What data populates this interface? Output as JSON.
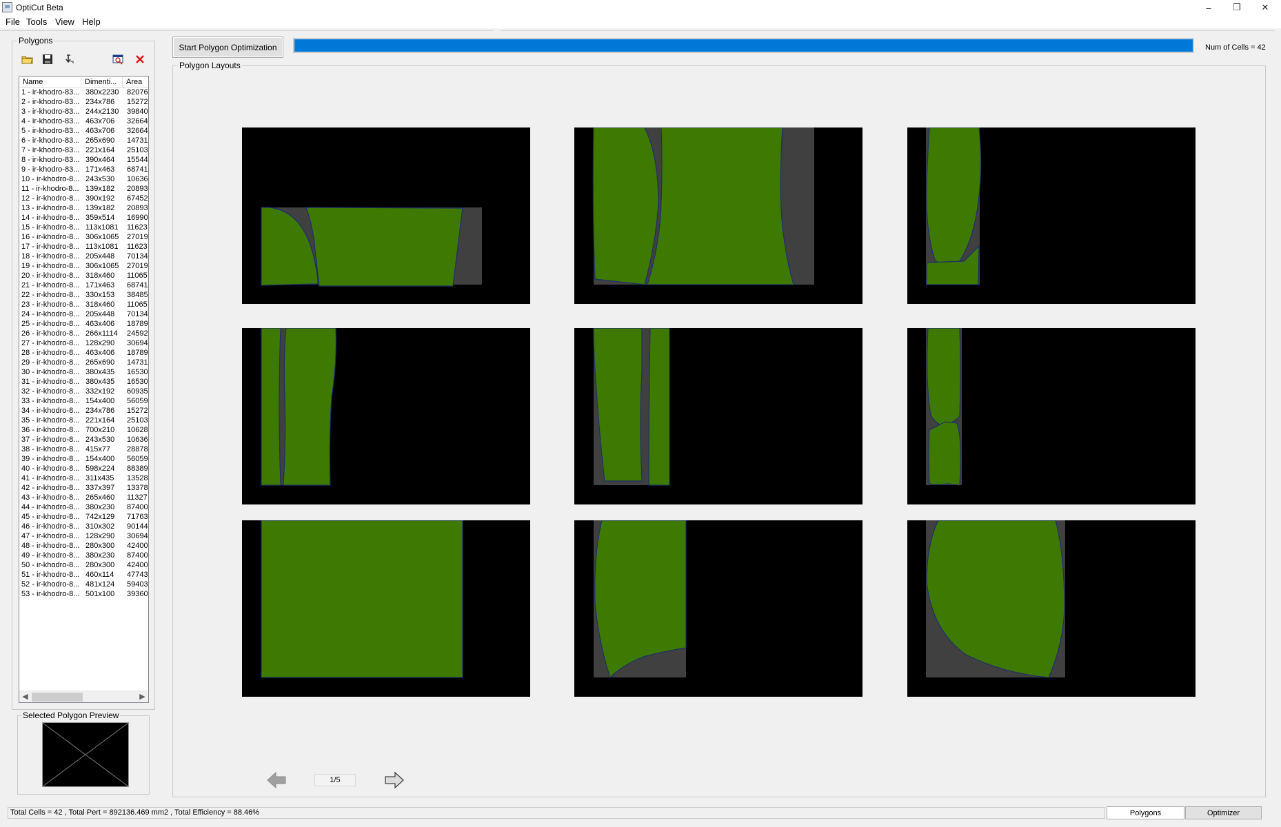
{
  "window": {
    "title": "OptiCut Beta",
    "minimize": "–",
    "restore": "❐",
    "close": "✕"
  },
  "menu": [
    "File",
    "Tools",
    "View",
    "Help"
  ],
  "polygons_panel": {
    "label": "Polygons",
    "toolbar_icons": [
      "open-folder-icon",
      "save-disk-icon",
      "import-icon",
      "zoom-preview-icon",
      "delete-icon"
    ],
    "columns": [
      "Name",
      "Dimenti...",
      "Area"
    ],
    "rows": [
      [
        "1 - ir-khodro-83...",
        "380x2230",
        "82076"
      ],
      [
        "2 - ir-khodro-83...",
        "234x786",
        "15272"
      ],
      [
        "3 - ir-khodro-83...",
        "244x2130",
        "39840"
      ],
      [
        "4 - ir-khodro-83...",
        "463x706",
        "32664"
      ],
      [
        "5 - ir-khodro-83...",
        "463x706",
        "32664"
      ],
      [
        "6 - ir-khodro-83...",
        "265x690",
        "14731"
      ],
      [
        "7 - ir-khodro-83...",
        "221x164",
        "25103"
      ],
      [
        "8 - ir-khodro-83...",
        "390x464",
        "15544"
      ],
      [
        "9 - ir-khodro-83...",
        "171x463",
        "68741"
      ],
      [
        "10 - ir-khodro-8...",
        "243x530",
        "10636"
      ],
      [
        "11 - ir-khodro-8...",
        "139x182",
        "20893"
      ],
      [
        "12 - ir-khodro-8...",
        "390x192",
        "67452"
      ],
      [
        "13 - ir-khodro-8...",
        "139x182",
        "20893"
      ],
      [
        "14 - ir-khodro-8...",
        "359x514",
        "16990"
      ],
      [
        "15 - ir-khodro-8...",
        "113x1081",
        "11623"
      ],
      [
        "16 - ir-khodro-8...",
        "306x1065",
        "27019"
      ],
      [
        "17 - ir-khodro-8...",
        "113x1081",
        "11623"
      ],
      [
        "18 - ir-khodro-8...",
        "205x448",
        "70134"
      ],
      [
        "19 - ir-khodro-8...",
        "306x1065",
        "27019"
      ],
      [
        "20 - ir-khodro-8...",
        "318x460",
        "11065"
      ],
      [
        "21 - ir-khodro-8...",
        "171x463",
        "68741"
      ],
      [
        "22 - ir-khodro-8...",
        "330x153",
        "38485"
      ],
      [
        "23 - ir-khodro-8...",
        "318x460",
        "11065"
      ],
      [
        "24 - ir-khodro-8...",
        "205x448",
        "70134"
      ],
      [
        "25 - ir-khodro-8...",
        "463x406",
        "18789"
      ],
      [
        "26 - ir-khodro-8...",
        "266x1114",
        "24592"
      ],
      [
        "27 - ir-khodro-8...",
        "128x290",
        "30694"
      ],
      [
        "28 - ir-khodro-8...",
        "463x406",
        "18789"
      ],
      [
        "29 - ir-khodro-8...",
        "265x690",
        "14731"
      ],
      [
        "30 - ir-khodro-8...",
        "380x435",
        "16530"
      ],
      [
        "31 - ir-khodro-8...",
        "380x435",
        "16530"
      ],
      [
        "32 - ir-khodro-8...",
        "332x192",
        "60935"
      ],
      [
        "33 - ir-khodro-8...",
        "154x400",
        "56059"
      ],
      [
        "34 - ir-khodro-8...",
        "234x786",
        "15272"
      ],
      [
        "35 - ir-khodro-8...",
        "221x164",
        "25103"
      ],
      [
        "36 - ir-khodro-8...",
        "700x210",
        "10628"
      ],
      [
        "37 - ir-khodro-8...",
        "243x530",
        "10636"
      ],
      [
        "38 - ir-khodro-8...",
        "415x77",
        "28878"
      ],
      [
        "39 - ir-khodro-8...",
        "154x400",
        "56059"
      ],
      [
        "40 - ir-khodro-8...",
        "598x224",
        "88389"
      ],
      [
        "41 - ir-khodro-8...",
        "311x435",
        "13528"
      ],
      [
        "42 - ir-khodro-8...",
        "337x397",
        "13378"
      ],
      [
        "43 - ir-khodro-8...",
        "265x460",
        "11327"
      ],
      [
        "44 - ir-khodro-8...",
        "380x230",
        "87400"
      ],
      [
        "45 - ir-khodro-8...",
        "742x129",
        "71763"
      ],
      [
        "46 - ir-khodro-8...",
        "310x302",
        "90144"
      ],
      [
        "47 - ir-khodro-8...",
        "128x290",
        "30694"
      ],
      [
        "48 - ir-khodro-8...",
        "280x300",
        "42400"
      ],
      [
        "49 - ir-khodro-8...",
        "380x230",
        "87400"
      ],
      [
        "50 - ir-khodro-8...",
        "280x300",
        "42400"
      ],
      [
        "51 - ir-khodro-8...",
        "460x114",
        "47743"
      ],
      [
        "52 - ir-khodro-8...",
        "481x124",
        "59403"
      ],
      [
        "53 - ir-khodro-8...",
        "501x100",
        "39360"
      ]
    ]
  },
  "preview": {
    "label": "Selected Polygon Preview"
  },
  "toolbar": {
    "start_label": "Start Polygon Optimization",
    "progress": 1.0,
    "num_cells": "Num of Cells = 42"
  },
  "layouts": {
    "label": "Polygon Layouts",
    "page_indicator": "1/5"
  },
  "status": {
    "summary": "Total Cells = 42 , Total Pert = 892136.469 mm2 , Total Efficiency = 88.46%",
    "tab_polygons": "Polygons",
    "tab_optimizer": "Optimizer"
  },
  "colors": {
    "polygon_fill": "#3e7a01",
    "polygon_stroke": "#1c2f6b",
    "sheet": "#404040",
    "background": "#000000",
    "accent": "#0078d7"
  }
}
